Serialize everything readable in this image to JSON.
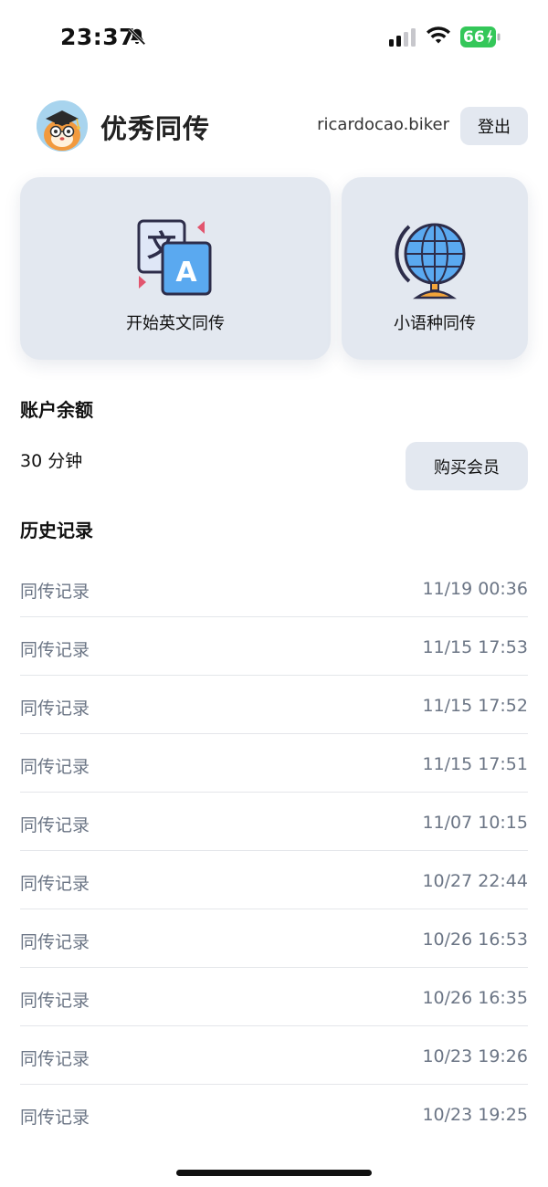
{
  "status_bar": {
    "time": "23:37",
    "battery": "66"
  },
  "header": {
    "app_name": "优秀同传",
    "username": "ricardocao.biker",
    "logout_label": "登出"
  },
  "cards": {
    "english": {
      "label": "开始英文同传",
      "icon": "translate-icon"
    },
    "minor": {
      "label": "小语种同传",
      "icon": "globe-icon"
    }
  },
  "balance": {
    "title": "账户余额",
    "value": "30 分钟",
    "buy_label": "购买会员"
  },
  "history": {
    "title": "历史记录",
    "items": [
      {
        "label": "同传记录",
        "time": "11/19 00:36"
      },
      {
        "label": "同传记录",
        "time": "11/15 17:53"
      },
      {
        "label": "同传记录",
        "time": "11/15 17:52"
      },
      {
        "label": "同传记录",
        "time": "11/15 17:51"
      },
      {
        "label": "同传记录",
        "time": "11/07 10:15"
      },
      {
        "label": "同传记录",
        "time": "10/27 22:44"
      },
      {
        "label": "同传记录",
        "time": "10/26 16:53"
      },
      {
        "label": "同传记录",
        "time": "10/26 16:35"
      },
      {
        "label": "同传记录",
        "time": "10/23 19:26"
      },
      {
        "label": "同传记录",
        "time": "10/23 19:25"
      }
    ]
  },
  "colors": {
    "accent_underline": "#7fb4f5",
    "card_bg": "#e3e8f0",
    "muted_text": "#6b7585",
    "battery_green": "#34c759"
  }
}
